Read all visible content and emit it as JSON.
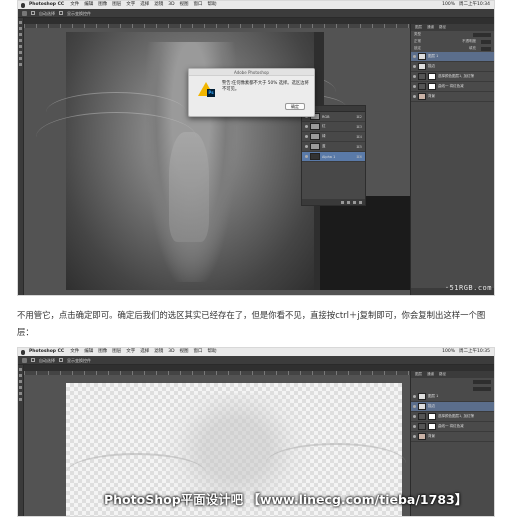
{
  "screenshot1": {
    "menubar": {
      "app": "Photoshop CC",
      "items": [
        "文件",
        "编辑",
        "图像",
        "图层",
        "文字",
        "选择",
        "滤镜",
        "3D",
        "视图",
        "窗口",
        "帮助"
      ],
      "right": [
        "100%",
        "周二上午10:34"
      ]
    },
    "options": {
      "auto_select": "自动选择",
      "show_transform": "显示变换控件"
    },
    "dialog": {
      "title": "Adobe Photoshop",
      "message": "警告:任何像素都不大于 50% 选择。选区边将不可见。",
      "ok": "确定",
      "badge": "Ps"
    },
    "channels": [
      {
        "name": "RGB",
        "key": "⌘2",
        "selected": false
      },
      {
        "name": "红",
        "key": "⌘3",
        "selected": false
      },
      {
        "name": "绿",
        "key": "⌘4",
        "selected": false
      },
      {
        "name": "蓝",
        "key": "⌘5",
        "selected": false
      },
      {
        "name": "Alpha 1",
        "key": "⌘6",
        "selected": true
      }
    ],
    "layers_panel": {
      "tabs": [
        "图层",
        "通道",
        "路径"
      ],
      "kind": "类型",
      "blend": "正常",
      "opacity_label": "不透明度",
      "lock": "锁定",
      "fill_label": "填充",
      "layers": [
        {
          "name": "图层 1",
          "selected": true
        },
        {
          "name": "描边",
          "selected": false
        },
        {
          "name": "选择颜色图层1, 加红筛",
          "selected": false
        },
        {
          "name": "曲线一 将红色减",
          "selected": false
        },
        {
          "name": "背景",
          "selected": false
        }
      ]
    },
    "watermark": "·51RGB.com"
  },
  "caption": "不用管它，点击确定即可。确定后我们的选区其实已经存在了，但是你看不见，直接按ctrl＋j复制即可，你会复制出这样一个图层：",
  "screenshot2": {
    "menubar": {
      "app": "Photoshop CC",
      "items": [
        "文件",
        "编辑",
        "图像",
        "图层",
        "文字",
        "选择",
        "滤镜",
        "3D",
        "视图",
        "窗口",
        "帮助"
      ],
      "right": [
        "100%",
        "周二上午10:35"
      ]
    },
    "options": {
      "auto_select": "自动选择",
      "show_transform": "显示变换控件"
    },
    "layers_panel": {
      "tabs": [
        "图层",
        "通道",
        "路径"
      ],
      "layers": [
        {
          "name": "图层 1",
          "selected": false
        },
        {
          "name": "描边",
          "selected": true
        },
        {
          "name": "选择颜色图层1, 加红筛",
          "selected": false
        },
        {
          "name": "曲线一 将红色减",
          "selected": false
        },
        {
          "name": "背景",
          "selected": false
        }
      ]
    },
    "brand": "PhotoShop平面设计吧 【www.linecg.com/tieba/1783】"
  }
}
